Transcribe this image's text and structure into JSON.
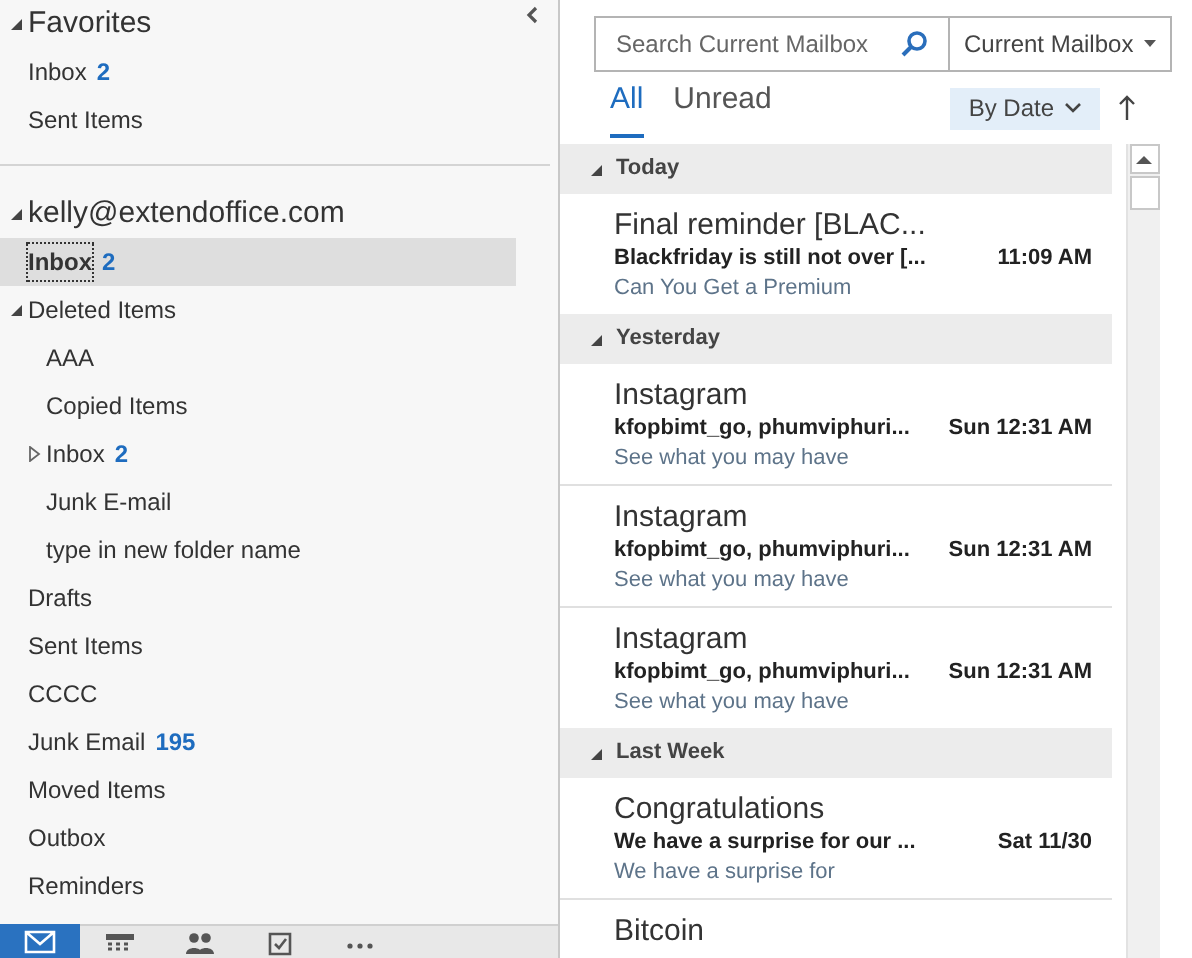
{
  "folder_pane": {
    "favorites": {
      "title": "Favorites",
      "expanded": true,
      "items": [
        {
          "label": "Inbox",
          "count": "2",
          "selected": false
        },
        {
          "label": "Sent Items",
          "selected": false
        }
      ]
    },
    "account": {
      "title": "kelly@extendoffice.com",
      "expanded": true,
      "children": [
        {
          "label": "Inbox",
          "count": "2",
          "selected": true
        },
        {
          "label": "Deleted Items",
          "expanded": true,
          "selected": false,
          "children": [
            {
              "label": "AAA",
              "selected": false
            },
            {
              "label": "Copied Items",
              "selected": false
            },
            {
              "label": "Inbox",
              "count": "2",
              "expanded": false,
              "selected": false
            },
            {
              "label": "Junk E-mail",
              "selected": false
            },
            {
              "label": "type in new folder name",
              "selected": false
            }
          ]
        },
        {
          "label": "Drafts",
          "selected": false
        },
        {
          "label": "Sent Items",
          "selected": false
        },
        {
          "label": "CCCC",
          "selected": false
        },
        {
          "label": "Junk Email",
          "count": "195",
          "selected": false
        },
        {
          "label": "Moved Items",
          "selected": false
        },
        {
          "label": "Outbox",
          "selected": false
        },
        {
          "label": "Reminders",
          "selected": false
        }
      ]
    }
  },
  "nav_bar": [
    {
      "kind": "mail",
      "selected": true
    },
    {
      "kind": "calendar",
      "selected": false
    },
    {
      "kind": "people",
      "selected": false
    },
    {
      "kind": "tasks",
      "selected": false
    },
    {
      "kind": "more",
      "selected": false
    }
  ],
  "search": {
    "placeholder": "Search Current Mailbox",
    "scope": "Current Mailbox"
  },
  "filter_tabs": [
    {
      "label": "All",
      "selected": true
    },
    {
      "label": "Unread",
      "selected": false
    }
  ],
  "sort": {
    "label": "By Date"
  },
  "groups": [
    {
      "title": "Today",
      "expanded": true,
      "messages": [
        {
          "sender": "Final reminder [BLAC...",
          "subject": "Blackfriday is still not over [...",
          "time": "11:09 AM",
          "preview": "Can You Get a Premium"
        }
      ]
    },
    {
      "title": "Yesterday",
      "expanded": true,
      "messages": [
        {
          "sender": "Instagram",
          "subject": "kfopbimt_go, phumviphuri...",
          "time": "Sun 12:31 AM",
          "preview": "See what you may have"
        },
        {
          "sender": "Instagram",
          "subject": "kfopbimt_go, phumviphuri...",
          "time": "Sun 12:31 AM",
          "preview": "See what you may have"
        },
        {
          "sender": "Instagram",
          "subject": "kfopbimt_go, phumviphuri...",
          "time": "Sun 12:31 AM",
          "preview": "See what you may have"
        }
      ]
    },
    {
      "title": "Last Week",
      "expanded": true,
      "messages": [
        {
          "sender": "Congratulations",
          "subject": "We have a surprise for our ...",
          "time": "Sat 11/30",
          "preview": "We have a surprise for"
        },
        {
          "sender": "Bitcoin"
        }
      ]
    }
  ]
}
